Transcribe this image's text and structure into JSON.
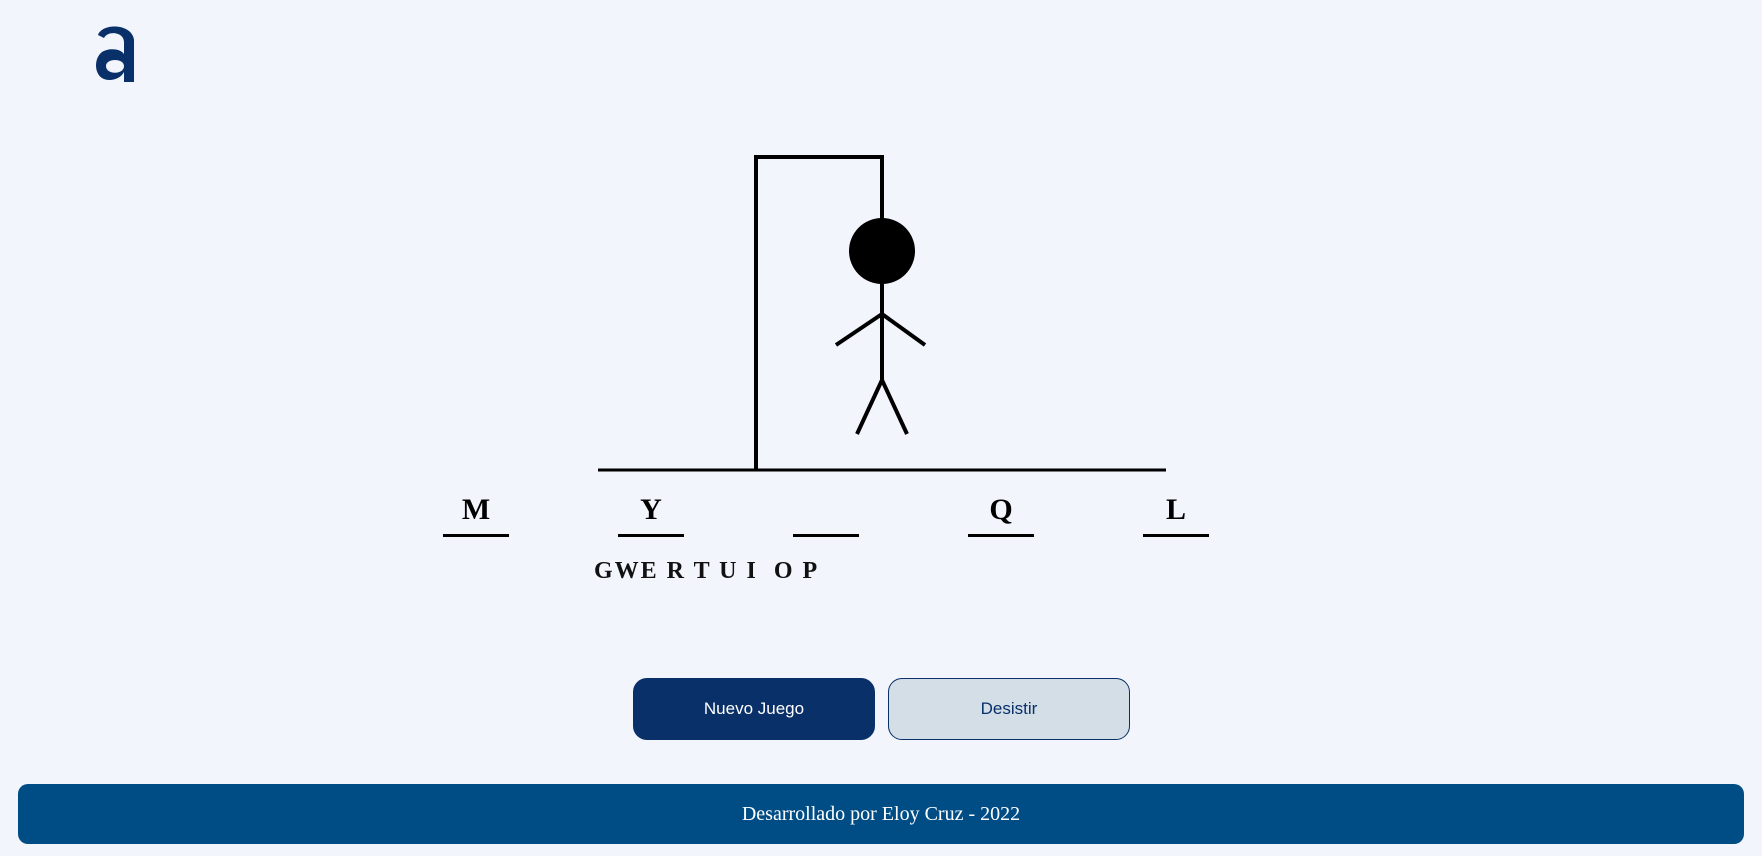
{
  "logo": {
    "icon": "alura-logo-icon",
    "color": "#0a3069"
  },
  "game": {
    "slots": [
      "M",
      "Y",
      "",
      "Q",
      "L"
    ],
    "wrong_letters": "GWE R T U I  O P"
  },
  "buttons": {
    "new_game": "Nuevo Juego",
    "give_up": "Desistir"
  },
  "footer": {
    "text": "Desarrollado por Eloy Cruz - 2022"
  },
  "colors": {
    "background": "#f2f5fc",
    "primary": "#0a3069",
    "secondary_button": "#d3dee7",
    "footer": "#004d85"
  }
}
